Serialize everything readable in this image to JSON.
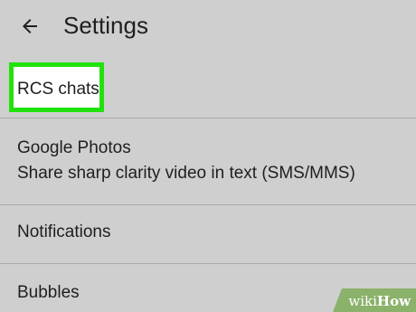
{
  "header": {
    "back_icon": "arrow-back-icon",
    "title": "Settings"
  },
  "items": [
    {
      "label": "RCS chats",
      "highlighted": true
    },
    {
      "label": "Google Photos",
      "sublabel": "Share sharp clarity video in text (SMS/MMS)"
    },
    {
      "label": "Notifications"
    },
    {
      "label": "Bubbles"
    }
  ],
  "highlight_color": "#22e20c",
  "watermark": {
    "prefix": "wiki",
    "suffix": "How"
  }
}
